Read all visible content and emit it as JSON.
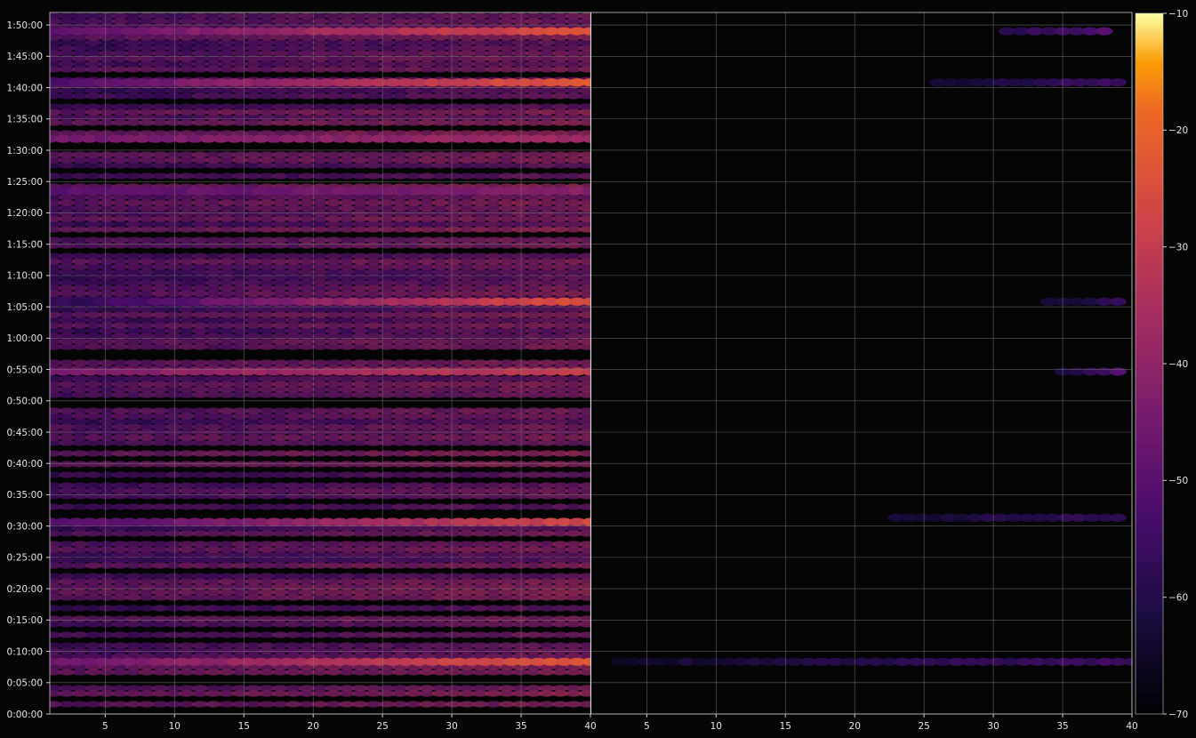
{
  "chart_data": {
    "type": "heatmap",
    "title": "",
    "xlabel": "",
    "ylabel": "",
    "colormap": "inferno",
    "background_color": "#050505",
    "grid": true,
    "grid_color": "#7a7a7a",
    "y_axis": {
      "range": [
        "0:00:00",
        "1:52:00"
      ],
      "tick_labels": [
        "0:00:00",
        "0:05:00",
        "0:10:00",
        "0:15:00",
        "0:20:00",
        "0:25:00",
        "0:30:00",
        "0:35:00",
        "0:40:00",
        "0:45:00",
        "0:50:00",
        "0:55:00",
        "1:00:00",
        "1:05:00",
        "1:10:00",
        "1:15:00",
        "1:20:00",
        "1:25:00",
        "1:30:00",
        "1:35:00",
        "1:40:00",
        "1:45:00",
        "1:50:00"
      ]
    },
    "panels": [
      {
        "name": "",
        "x_range": [
          1,
          40
        ],
        "x_tick_labels": [
          "5",
          "10",
          "15",
          "20",
          "25",
          "30",
          "35",
          "40"
        ]
      },
      {
        "name": "",
        "x_range": [
          1,
          40
        ],
        "x_tick_labels": [
          "5",
          "10",
          "15",
          "20",
          "25",
          "30",
          "35",
          "40"
        ]
      }
    ],
    "colorbar": {
      "range": [
        -70,
        -10
      ],
      "tick_labels": [
        "−10",
        "−20",
        "−30",
        "−40",
        "−50",
        "−60",
        "−70"
      ],
      "tick_values": [
        -10,
        -20,
        -30,
        -40,
        -50,
        -60,
        -70
      ]
    },
    "bands": [
      {
        "time": "0:08:20",
        "panel": 1,
        "x_from": 1,
        "x_to": 40,
        "level_start": -47,
        "level_end": -22
      },
      {
        "time": "0:08:20",
        "panel": 2,
        "x_from": 3,
        "x_to": 40,
        "level_start": -64,
        "level_end": -55
      },
      {
        "time": "0:30:40",
        "panel": 1,
        "x_from": 1,
        "x_to": 40,
        "level_start": -52,
        "level_end": -27
      },
      {
        "time": "0:31:20",
        "panel": 2,
        "x_from": 23,
        "x_to": 39,
        "level_start": -63,
        "level_end": -57
      },
      {
        "time": "0:54:40",
        "panel": 1,
        "x_from": 1,
        "x_to": 40,
        "level_start": -44,
        "level_end": -30
      },
      {
        "time": "0:54:40",
        "panel": 2,
        "x_from": 35,
        "x_to": 39,
        "level_start": -62,
        "level_end": -52
      },
      {
        "time": "1:05:50",
        "panel": 1,
        "x_from": 1,
        "x_to": 40,
        "level_start": -58,
        "level_end": -24
      },
      {
        "time": "1:05:50",
        "panel": 2,
        "x_from": 34,
        "x_to": 39,
        "level_start": -64,
        "level_end": -58
      },
      {
        "time": "1:23:30",
        "panel": 1,
        "x_from": 1,
        "x_to": 40,
        "level_start": -50,
        "level_end": -42
      },
      {
        "time": "1:31:50",
        "panel": 1,
        "x_from": 1,
        "x_to": 40,
        "level_start": -46,
        "level_end": -36
      },
      {
        "time": "1:40:50",
        "panel": 1,
        "x_from": 1,
        "x_to": 40,
        "level_start": -52,
        "level_end": -22
      },
      {
        "time": "1:40:50",
        "panel": 2,
        "x_from": 26,
        "x_to": 39,
        "level_start": -63,
        "level_end": -55
      },
      {
        "time": "1:49:00",
        "panel": 1,
        "x_from": 1,
        "x_to": 40,
        "level_start": -50,
        "level_end": -24
      },
      {
        "time": "1:49:00",
        "panel": 2,
        "x_from": 31,
        "x_to": 38,
        "level_start": -58,
        "level_end": -52
      }
    ]
  }
}
